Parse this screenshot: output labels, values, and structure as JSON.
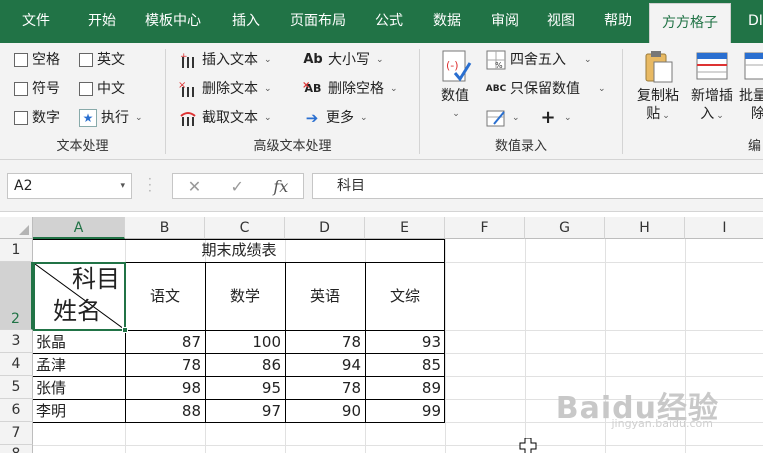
{
  "tabs": [
    {
      "label": "文件"
    },
    {
      "label": "开始"
    },
    {
      "label": "模板中心"
    },
    {
      "label": "插入"
    },
    {
      "label": "页面布局"
    },
    {
      "label": "公式"
    },
    {
      "label": "数据"
    },
    {
      "label": "审阅"
    },
    {
      "label": "视图"
    },
    {
      "label": "帮助"
    },
    {
      "label": "方方格子"
    },
    {
      "label": "DI"
    }
  ],
  "ribbon": {
    "text_processing": {
      "label": "文本处理",
      "items": [
        {
          "label": "空格"
        },
        {
          "label": "英文"
        },
        {
          "label": "符号"
        },
        {
          "label": "中文"
        },
        {
          "label": "数字"
        },
        {
          "label": "执行"
        }
      ]
    },
    "advanced_text": {
      "label": "高级文本处理",
      "items": [
        {
          "label": "插入文本"
        },
        {
          "label": "删除文本"
        },
        {
          "label": "截取文本"
        },
        {
          "label": "大小写"
        },
        {
          "label": "删除空格"
        },
        {
          "label": "更多"
        }
      ],
      "icon_text": {
        "case": "Ab",
        "space": "AB"
      }
    },
    "number_entry": {
      "label": "数值录入",
      "number_btn": "数值",
      "round_label": "四舍五入",
      "keep_label": "只保留数值",
      "abc": "ABC",
      "plus": "+"
    },
    "next": {
      "copy_paste": [
        "复制粘",
        "贴"
      ],
      "new_insert": [
        "新增插",
        "入"
      ],
      "batch": [
        "批量",
        "除"
      ],
      "edit_partial": "编"
    }
  },
  "formula_bar": {
    "name_box": "A2",
    "cancel": "✕",
    "enter": "✓",
    "fx": "fx",
    "value": "科目"
  },
  "sheet": {
    "columns": [
      "A",
      "B",
      "C",
      "D",
      "E",
      "F",
      "G",
      "H",
      "I"
    ],
    "rows": [
      "1",
      "2",
      "3",
      "4",
      "5",
      "6",
      "7",
      "8"
    ],
    "title": "期末成绩表",
    "diagonal_top": "科目",
    "diagonal_bottom": "姓名",
    "headers": [
      "语文",
      "数学",
      "英语",
      "文综"
    ],
    "data": [
      {
        "name": "张晶",
        "values": [
          "87",
          "100",
          "78",
          "93"
        ]
      },
      {
        "name": "孟津",
        "values": [
          "78",
          "86",
          "94",
          "85"
        ]
      },
      {
        "name": "张倩",
        "values": [
          "98",
          "95",
          "78",
          "89"
        ]
      },
      {
        "name": "李明",
        "values": [
          "88",
          "97",
          "90",
          "99"
        ]
      }
    ]
  },
  "watermark": {
    "main": "Baidu经验",
    "sub": "jingyan.baidu.com"
  },
  "colors": {
    "accent": "#217346",
    "ribbon": "#f3f3f3"
  }
}
